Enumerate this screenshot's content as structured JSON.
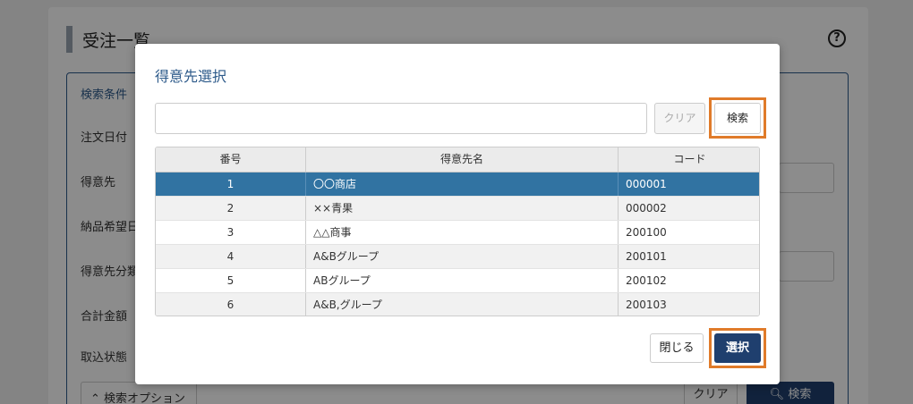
{
  "background": {
    "page_title": "受注一覧",
    "help_icon": "?",
    "panel_title": "検索条件",
    "labels": [
      "注文日付",
      "得意先",
      "納品希望日",
      "得意先分類",
      "合計金額",
      "取込状態"
    ],
    "options_button": "検索オプション",
    "clear_button": "クリア",
    "search_button": "検索"
  },
  "modal": {
    "title": "得意先選択",
    "search_input": {
      "value": "",
      "placeholder": ""
    },
    "clear_button": "クリア",
    "search_button": "検索",
    "table": {
      "columns": [
        "番号",
        "得意先名",
        "コード"
      ],
      "rows": [
        {
          "no": "1",
          "name": "〇〇商店",
          "code": "000001",
          "selected": true
        },
        {
          "no": "2",
          "name": "××青果",
          "code": "000002",
          "selected": false
        },
        {
          "no": "3",
          "name": "△△商事",
          "code": "200100",
          "selected": false
        },
        {
          "no": "4",
          "name": "A&Bグループ",
          "code": "200101",
          "selected": false
        },
        {
          "no": "5",
          "name": "ABグループ",
          "code": "200102",
          "selected": false
        },
        {
          "no": "6",
          "name": "A&B,グループ",
          "code": "200103",
          "selected": false
        }
      ]
    },
    "close_button": "閉じる",
    "select_button": "選択"
  },
  "colors": {
    "accent": "#1f3f6e",
    "selected_row": "#3173a2",
    "highlight": "#e07b2a"
  }
}
